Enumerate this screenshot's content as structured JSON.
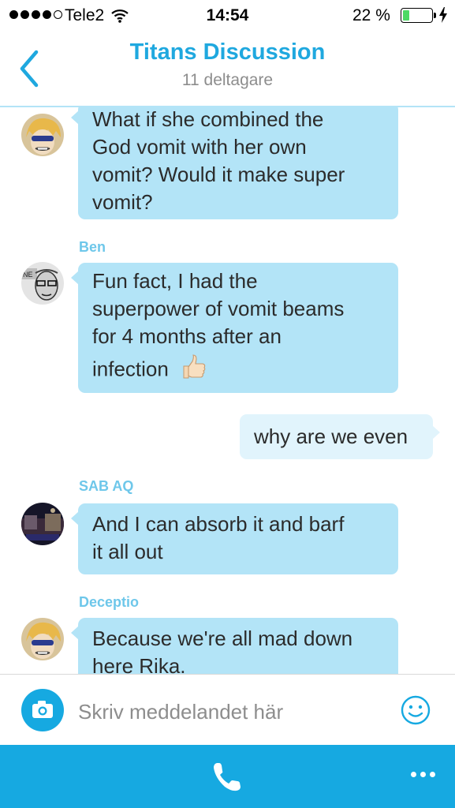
{
  "status_bar": {
    "carrier": "Tele2",
    "time": "14:54",
    "battery_percent": "22 %",
    "battery_level": 0.22,
    "signal_bars_filled": 4,
    "signal_bars_total": 5
  },
  "header": {
    "back_icon": "chevron-left-icon",
    "title": "Titans Discussion",
    "subtitle": "11 deltagare"
  },
  "messages": [
    {
      "sender": "",
      "direction": "in",
      "lines": [
        "What if she combined the",
        "God vomit with her own",
        "vomit? Would it make super",
        "vomit?"
      ]
    },
    {
      "sender": "Ben",
      "direction": "in",
      "lines": [
        "Fun fact, I had the",
        "superpower of vomit beams",
        "for 4 months after an",
        "infection"
      ],
      "emoji": "thumbs-up-icon"
    },
    {
      "sender": "",
      "direction": "out",
      "lines": [
        "why are we even"
      ]
    },
    {
      "sender": "SAB AQ",
      "direction": "in",
      "lines": [
        "And I can absorb it and barf",
        "it all out"
      ]
    },
    {
      "sender": "Deceptio",
      "direction": "in",
      "lines": [
        "Because we're all mad down",
        "here Rika."
      ]
    }
  ],
  "composer": {
    "placeholder": "Skriv meddelandet här",
    "camera_icon": "camera-icon",
    "emoji_icon": "smiley-icon"
  },
  "bottom_bar": {
    "call_icon": "phone-icon",
    "more_icon": "more-dots-icon"
  },
  "colors": {
    "accent": "#16a9e1",
    "title": "#1fa8df",
    "incoming_bubble": "#b3e4f7",
    "outgoing_bubble": "#e1f4fc",
    "sender_name": "#6ec7ea",
    "battery": "#4cd964"
  }
}
